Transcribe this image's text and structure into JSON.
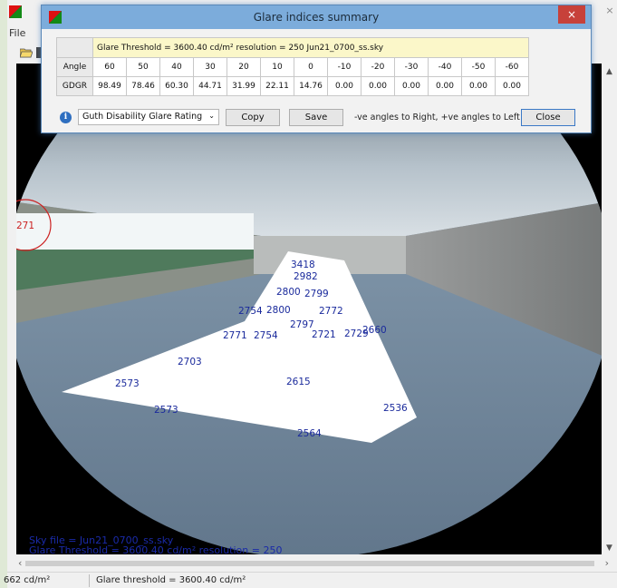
{
  "app": {
    "menu_file": "File",
    "close_glyph": "×"
  },
  "viewport": {
    "overlay_line1": "Sky file = Jun21_0700_ss.sky",
    "overlay_line2": "Glare Threshold = 3600.40 cd/m²  resolution = 250",
    "left_marker": "271",
    "glare_values": [
      "3418",
      "2982",
      "2800",
      "2799",
      "2754",
      "2800",
      "2772",
      "2797",
      "2771",
      "2754",
      "2721",
      "2729",
      "2660",
      "2703",
      "2573",
      "2615",
      "2573",
      "2536",
      "2564"
    ]
  },
  "status": {
    "luminance": "662 cd/m²",
    "threshold": "Glare threshold = 3600.40 cd/m²"
  },
  "dialog": {
    "title": "Glare indices summary",
    "close_glyph": "×",
    "info_line": "Glare Threshold = 3600.40 cd/m²    resolution = 250    Jun21_0700_ss.sky",
    "row_angle_label": "Angle",
    "row_gdgr_label": "GDGR",
    "angles": [
      "60",
      "50",
      "40",
      "30",
      "20",
      "10",
      "0",
      "-10",
      "-20",
      "-30",
      "-40",
      "-50",
      "-60"
    ],
    "gdgr": [
      "98.49",
      "78.46",
      "60.30",
      "44.71",
      "31.99",
      "22.11",
      "14.76",
      "0.00",
      "0.00",
      "0.00",
      "0.00",
      "0.00",
      "0.00"
    ],
    "rating_selected": "Guth Disability Glare Rating",
    "copy_label": "Copy",
    "save_label": "Save",
    "note": "-ve angles to Right, +ve angles to Left",
    "close_label": "Close"
  }
}
